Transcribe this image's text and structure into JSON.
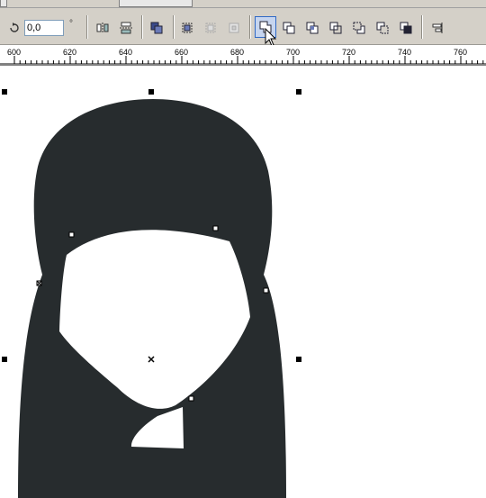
{
  "toolbar": {
    "rotation_value": "0,0",
    "degree_symbol": "°"
  },
  "ruler": {
    "labels": [
      "600",
      "620",
      "640",
      "660",
      "680",
      "700",
      "720",
      "740",
      "760"
    ]
  },
  "colors": {
    "shape_fill": "#272c2e",
    "toolbar_bg": "#d4d0c8",
    "active_button": "#316ac5"
  },
  "icons": [
    "rotate-icon",
    "mirror-horizontal-icon",
    "mirror-vertical-icon",
    "to-curves-icon",
    "group-icon",
    "ungroup-icon",
    "combine-icon",
    "weld-icon",
    "trim-icon",
    "intersect-icon",
    "simplify-icon",
    "front-minus-back-icon",
    "back-minus-front-icon",
    "create-boundary-icon",
    "align-icon"
  ]
}
